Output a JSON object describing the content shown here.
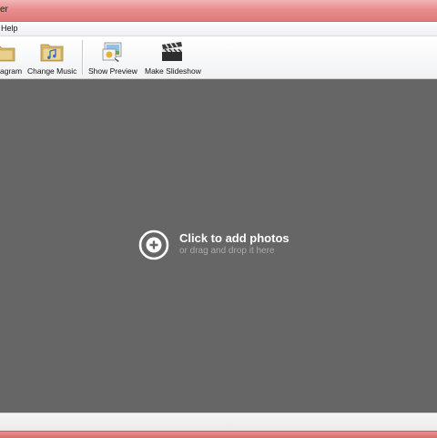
{
  "window": {
    "title": "er"
  },
  "menu": {
    "items": [
      "Help"
    ]
  },
  "toolbar": {
    "buttons": [
      {
        "label": "agram",
        "icon": "folder-picture-icon"
      },
      {
        "label": "Change Music",
        "icon": "music-folder-icon"
      },
      {
        "label": "Show Preview",
        "icon": "preview-photos-icon"
      },
      {
        "label": "Make Slideshow",
        "icon": "clapperboard-icon"
      }
    ]
  },
  "canvas": {
    "add_title": "Click to add photos",
    "add_subtitle": "or drag and drop it here",
    "add_icon": "plus-circle-icon"
  },
  "colors": {
    "title_bar": "#e07b7b",
    "canvas_bg": "#666666",
    "add_title": "#ffffff",
    "add_subtitle": "#a9a9a9"
  }
}
